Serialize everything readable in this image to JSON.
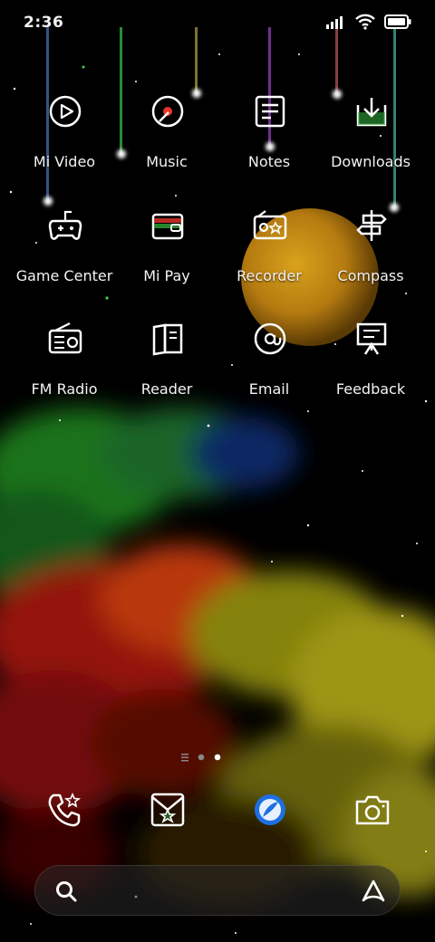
{
  "status_bar": {
    "time": "2:36",
    "icons": [
      "signal-icon",
      "wifi-icon",
      "battery-icon"
    ]
  },
  "apps": [
    {
      "label": "Mi Video",
      "icon": "play-icon"
    },
    {
      "label": "Music",
      "icon": "music-disc-icon"
    },
    {
      "label": "Notes",
      "icon": "notes-icon"
    },
    {
      "label": "Downloads",
      "icon": "download-icon"
    },
    {
      "label": "Game Center",
      "icon": "gamepad-icon"
    },
    {
      "label": "Mi Pay",
      "icon": "wallet-icon"
    },
    {
      "label": "Recorder",
      "icon": "recorder-icon"
    },
    {
      "label": "Compass",
      "icon": "signpost-icon"
    },
    {
      "label": "FM Radio",
      "icon": "radio-icon"
    },
    {
      "label": "Reader",
      "icon": "book-icon"
    },
    {
      "label": "Email",
      "icon": "at-icon"
    },
    {
      "label": "Feedback",
      "icon": "easel-icon"
    }
  ],
  "pager": {
    "pages": 2,
    "current": 2,
    "has_feed": true
  },
  "dock": [
    "phone-icon",
    "messages-icon",
    "browser-icon",
    "camera-icon"
  ],
  "search": {
    "icons": [
      "search-icon",
      "assistant-icon"
    ]
  },
  "colors": {
    "accent_red": "#e8362c",
    "accent_orange": "#f08a1c",
    "accent_yellow": "#f2d21a",
    "accent_green": "#2ea83a",
    "accent_blue": "#1f6fe0",
    "accent_purple": "#8c2bd0"
  }
}
